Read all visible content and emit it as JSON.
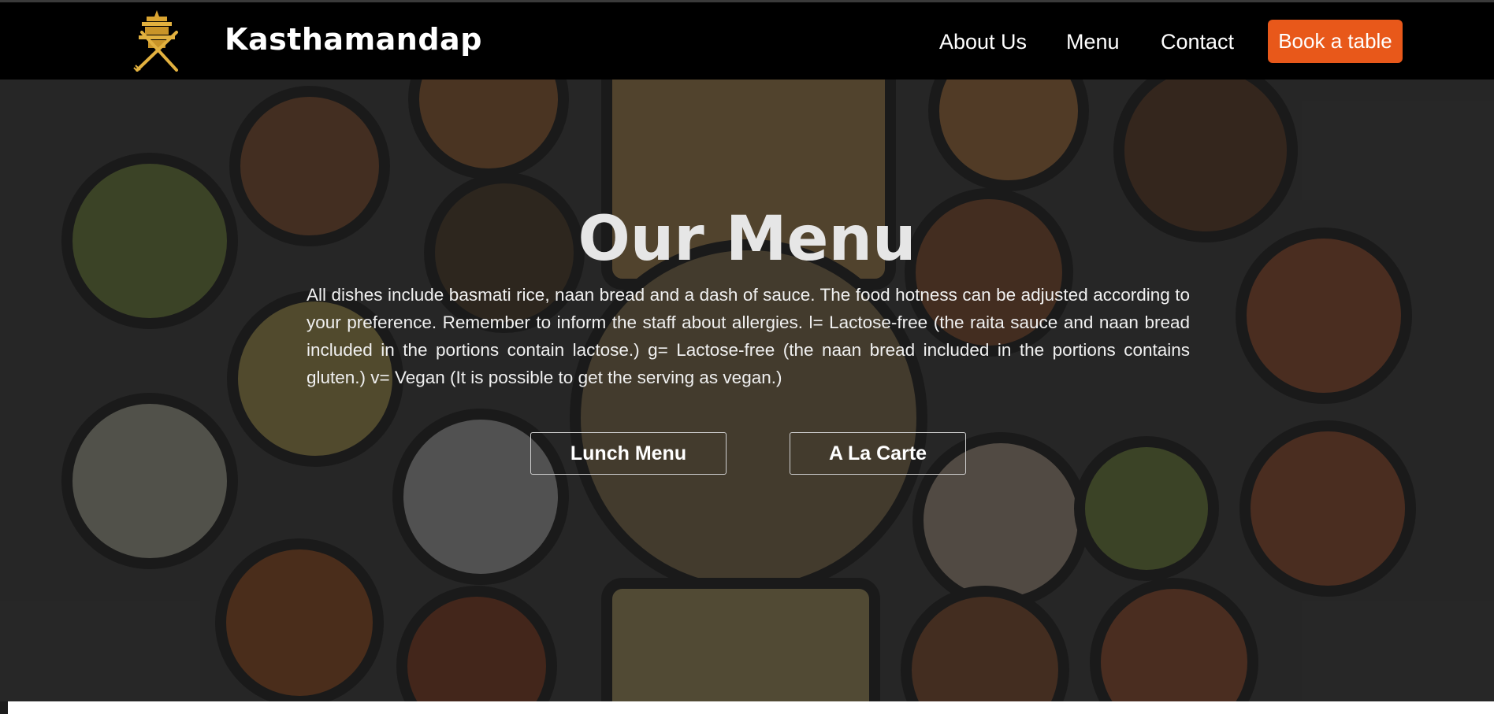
{
  "header": {
    "brand": "Kasthamandap",
    "nav": [
      "About Us",
      "Menu",
      "Contact"
    ],
    "cta": "Book a table"
  },
  "hero": {
    "title": "Our Menu",
    "description": "All dishes include basmati rice, naan bread and a dash of sauce. The food hotness can be adjusted according to your preference. Remember to inform the staff about allergies. l= Lactose-free (the raita sauce and naan bread included in the portions contain lactose.) g= Lactose-free (the naan bread included in the portions contains gluten.) v= Vegan (It is possible to get the serving as vegan.)",
    "buttons": [
      "Lunch Menu",
      "A La Carte"
    ]
  },
  "colors": {
    "header_bg": "#000000",
    "accent": "#e8581a",
    "logo_gold": "#d9a431"
  }
}
